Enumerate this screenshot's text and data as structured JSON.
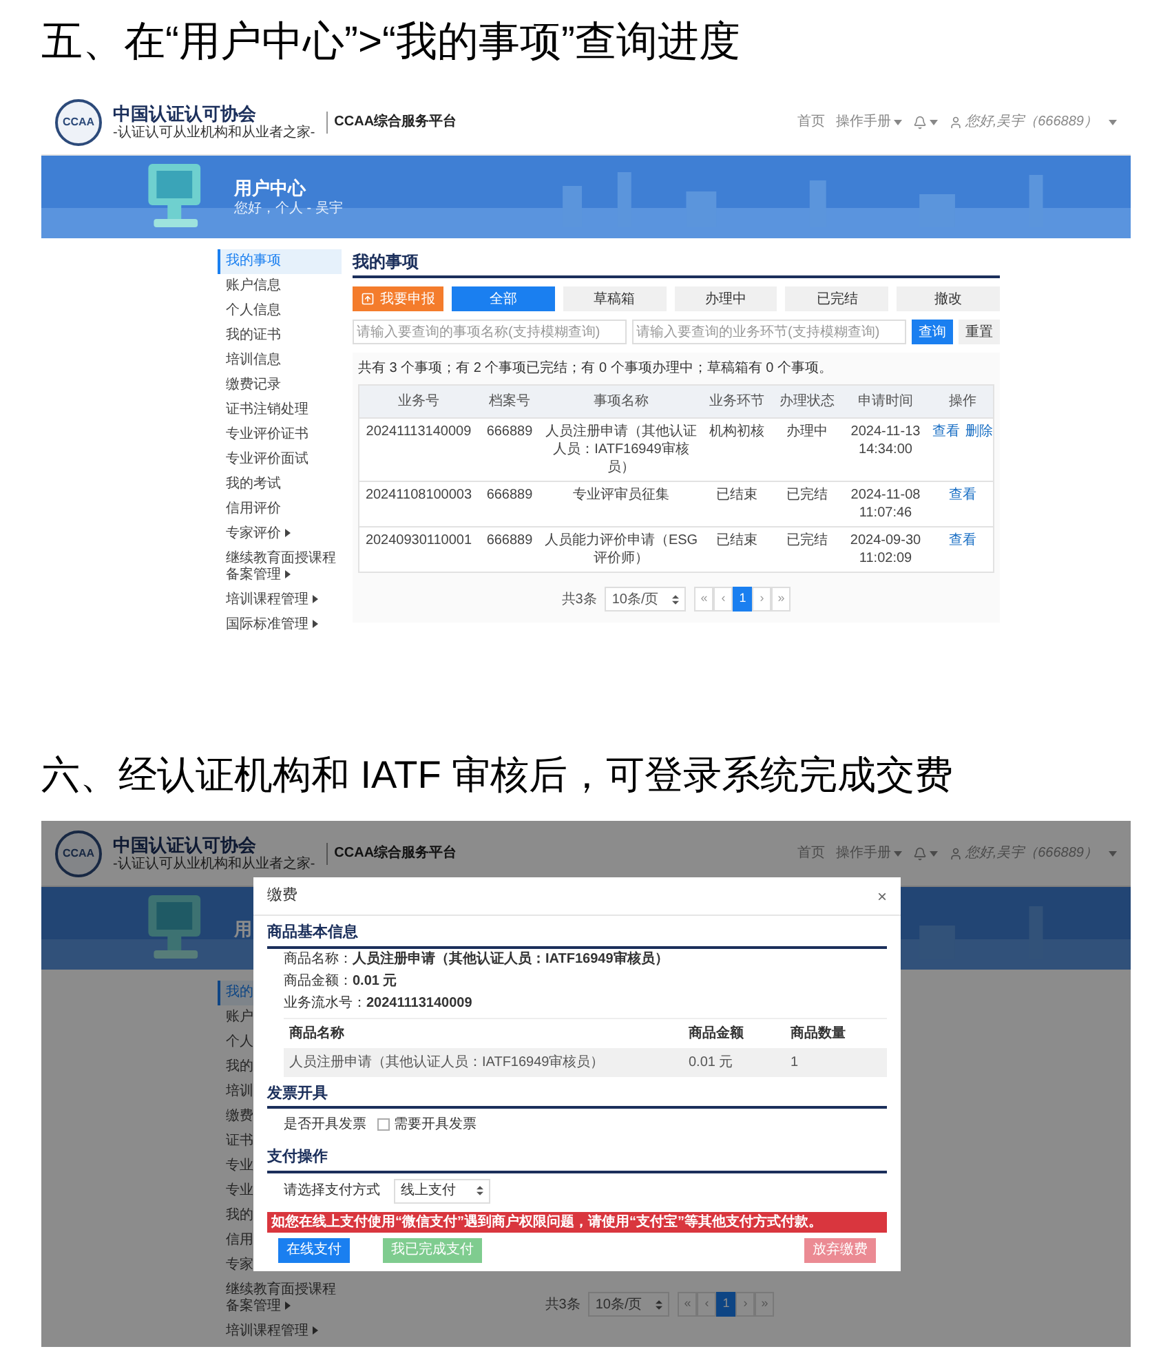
{
  "section_1": {
    "heading": "五、在“用户中心”>“我的事项”查询进度",
    "header": {
      "logo_text": "CCAA",
      "org_name": "中国认证认可协会",
      "slogan": "-认证认可从业机构和从业者之家-",
      "platform": "CCAA综合服务平台",
      "nav": [
        {
          "label": "首页",
          "dropdown": false
        },
        {
          "label": "操作手册",
          "dropdown": true
        }
      ],
      "user": "您好,吴宇（666889）"
    },
    "banner": {
      "title": "用户中心",
      "subtitle": "您好，个人 - 吴宇"
    },
    "sidebar": [
      {
        "label": "我的事项",
        "selected": true,
        "submenu": false
      },
      {
        "label": "账户信息",
        "selected": false,
        "submenu": false
      },
      {
        "label": "个人信息",
        "selected": false,
        "submenu": false
      },
      {
        "label": "我的证书",
        "selected": false,
        "submenu": false
      },
      {
        "label": "培训信息",
        "selected": false,
        "submenu": false
      },
      {
        "label": "缴费记录",
        "selected": false,
        "submenu": false
      },
      {
        "label": "证书注销处理",
        "selected": false,
        "submenu": false
      },
      {
        "label": "专业评价证书",
        "selected": false,
        "submenu": false
      },
      {
        "label": "专业评价面试",
        "selected": false,
        "submenu": false
      },
      {
        "label": "我的考试",
        "selected": false,
        "submenu": false
      },
      {
        "label": "信用评价",
        "selected": false,
        "submenu": false
      },
      {
        "label": "专家评价",
        "selected": false,
        "submenu": true
      },
      {
        "label": "继续教育面授课程备案管理",
        "selected": false,
        "submenu": true
      },
      {
        "label": "培训课程管理",
        "selected": false,
        "submenu": true
      },
      {
        "label": "国际标准管理",
        "selected": false,
        "submenu": true
      }
    ],
    "main": {
      "title": "我的事项",
      "apply_button": "我要申报",
      "tabs": [
        {
          "label": "全部",
          "selected": true
        },
        {
          "label": "草稿箱",
          "selected": false
        },
        {
          "label": "办理中",
          "selected": false
        },
        {
          "label": "已完结",
          "selected": false
        },
        {
          "label": "撤改",
          "selected": false
        }
      ],
      "search_fields": [
        {
          "placeholder": "请输入要查询的事项名称(支持模糊查询)"
        },
        {
          "placeholder": "请输入要查询的业务环节(支持模糊查询)"
        }
      ],
      "query_button": "查询",
      "reset_button": "重置",
      "summary": "共有 3 个事项；有 2 个事项已完结；有 0 个事项办理中；草稿箱有 0 个事项。",
      "table": {
        "columns": [
          "业务号",
          "档案号",
          "事项名称",
          "业务环节",
          "办理状态",
          "申请时间",
          "操作"
        ],
        "rows": [
          {
            "cells": [
              "20241113140009",
              "666889",
              "人员注册申请（其他认证人员：IATF16949审核员）",
              "机构初核",
              "办理中",
              "2024-11-13 14:34:00"
            ],
            "actions": [
              "查看",
              "删除"
            ]
          },
          {
            "cells": [
              "20241108100003",
              "666889",
              "专业评审员征集",
              "已结束",
              "已完结",
              "2024-11-08 11:07:46"
            ],
            "actions": [
              "查看"
            ]
          },
          {
            "cells": [
              "20240930110001",
              "666889",
              "人员能力评价申请（ESG评价师）",
              "已结束",
              "已完结",
              "2024-09-30 11:02:09"
            ],
            "actions": [
              "查看"
            ]
          }
        ]
      },
      "pagination": {
        "total": "共3条",
        "page_size": "10条/页",
        "pages": [
          {
            "label": "«",
            "selected": false
          },
          {
            "label": "‹",
            "selected": false
          },
          {
            "label": "1",
            "selected": true
          },
          {
            "label": "›",
            "selected": false
          },
          {
            "label": "»",
            "selected": false
          }
        ]
      }
    }
  },
  "section_2": {
    "heading": "六、经认证机构和 IATF 审核后，可登录系统完成交费",
    "header": {
      "logo_text": "CCAA",
      "org_name": "中国认证认可协会",
      "slogan": "-认证认可从业机构和从业者之家-",
      "platform": "CCAA综合服务平台",
      "nav": [
        {
          "label": "首页",
          "dropdown": false
        },
        {
          "label": "操作手册",
          "dropdown": true
        }
      ],
      "user": "您好,吴宇（666889）"
    },
    "banner": {
      "title": "用"
    },
    "sidebar": [
      {
        "label": "我的",
        "selected": true
      },
      {
        "label": "账户",
        "selected": false
      },
      {
        "label": "个人",
        "selected": false
      },
      {
        "label": "我的",
        "selected": false
      },
      {
        "label": "培训",
        "selected": false
      },
      {
        "label": "缴费",
        "selected": false
      },
      {
        "label": "证书",
        "selected": false
      },
      {
        "label": "专业",
        "selected": false
      },
      {
        "label": "专业",
        "selected": false
      },
      {
        "label": "我的",
        "selected": false
      },
      {
        "label": "信用",
        "selected": false
      },
      {
        "label": "专家",
        "selected": false
      },
      {
        "label": "继续教育面授课程备案管理",
        "selected": false,
        "submenu": true
      },
      {
        "label": "培训课程管理",
        "selected": false,
        "submenu": true
      }
    ],
    "pagination": {
      "total": "共3条",
      "page_size": "10条/页",
      "pages": [
        {
          "label": "«",
          "selected": false
        },
        {
          "label": "‹",
          "selected": false
        },
        {
          "label": "1",
          "selected": true
        },
        {
          "label": "›",
          "selected": false
        },
        {
          "label": "»",
          "selected": false
        }
      ]
    },
    "modal": {
      "title": "缴费",
      "close": "×",
      "goods_section": {
        "heading": "商品基本信息",
        "fields": [
          {
            "label": "商品名称：",
            "value": "人员注册申请（其他认证人员：IATF16949审核员）"
          },
          {
            "label": "商品金额：",
            "value": "0.01 元"
          },
          {
            "label": "业务流水号：",
            "value": "20241113140009"
          }
        ],
        "table": {
          "columns": [
            "商品名称",
            "商品金额",
            "商品数量"
          ],
          "rows": [
            [
              "人员注册申请（其他认证人员：IATF16949审核员）",
              "0.01 元",
              "1"
            ]
          ]
        }
      },
      "invoice_section": {
        "heading": "发票开具",
        "label": "是否开具发票",
        "checkbox": {
          "label": "需要开具发票",
          "checked": false
        }
      },
      "payment_section": {
        "heading": "支付操作",
        "label": "请选择支付方式",
        "select_value": "线上支付",
        "warning": "如您在线上支付使用“微信支付”遇到商户权限问题，请使用“支付宝”等其他支付方式付款。",
        "buttons": [
          {
            "label": "在线支付",
            "kind": "primary",
            "disabled": false
          },
          {
            "label": "我已完成支付",
            "kind": "success",
            "disabled": true
          },
          {
            "label": "放弃缴费",
            "kind": "danger",
            "disabled": true
          }
        ]
      }
    }
  }
}
